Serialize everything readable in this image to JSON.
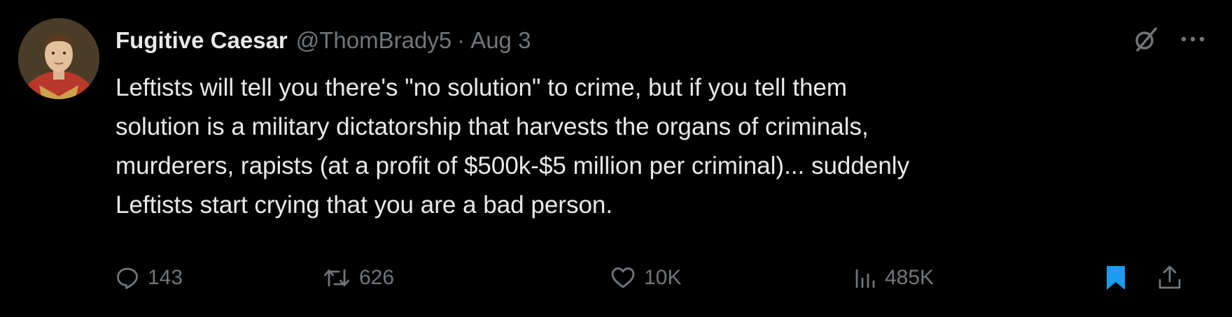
{
  "tweet": {
    "author": {
      "display_name": "Fugitive Caesar",
      "handle": "@ThomBrady5",
      "separator": "·",
      "date": "Aug 3",
      "avatar_icon": "portrait-avatar"
    },
    "header_icons": [
      "grok-icon",
      "more-icon"
    ],
    "text_lines": [
      "Leftists will tell you there's \"no solution\" to crime, but if you tell them",
      "solution is a military dictatorship that harvests the organs of criminals,",
      "murderers, rapists (at a profit of $500k-$5 million per criminal)... suddenly",
      "Leftists start crying that you are a bad person."
    ],
    "stats": {
      "replies": "143",
      "reposts": "626",
      "likes": "10K",
      "views": "485K"
    },
    "bookmarked": true
  },
  "colors": {
    "background": "#000000",
    "text": "#e7e9ea",
    "muted": "#71767b",
    "bookmark_accent": "#1d9bf0"
  }
}
